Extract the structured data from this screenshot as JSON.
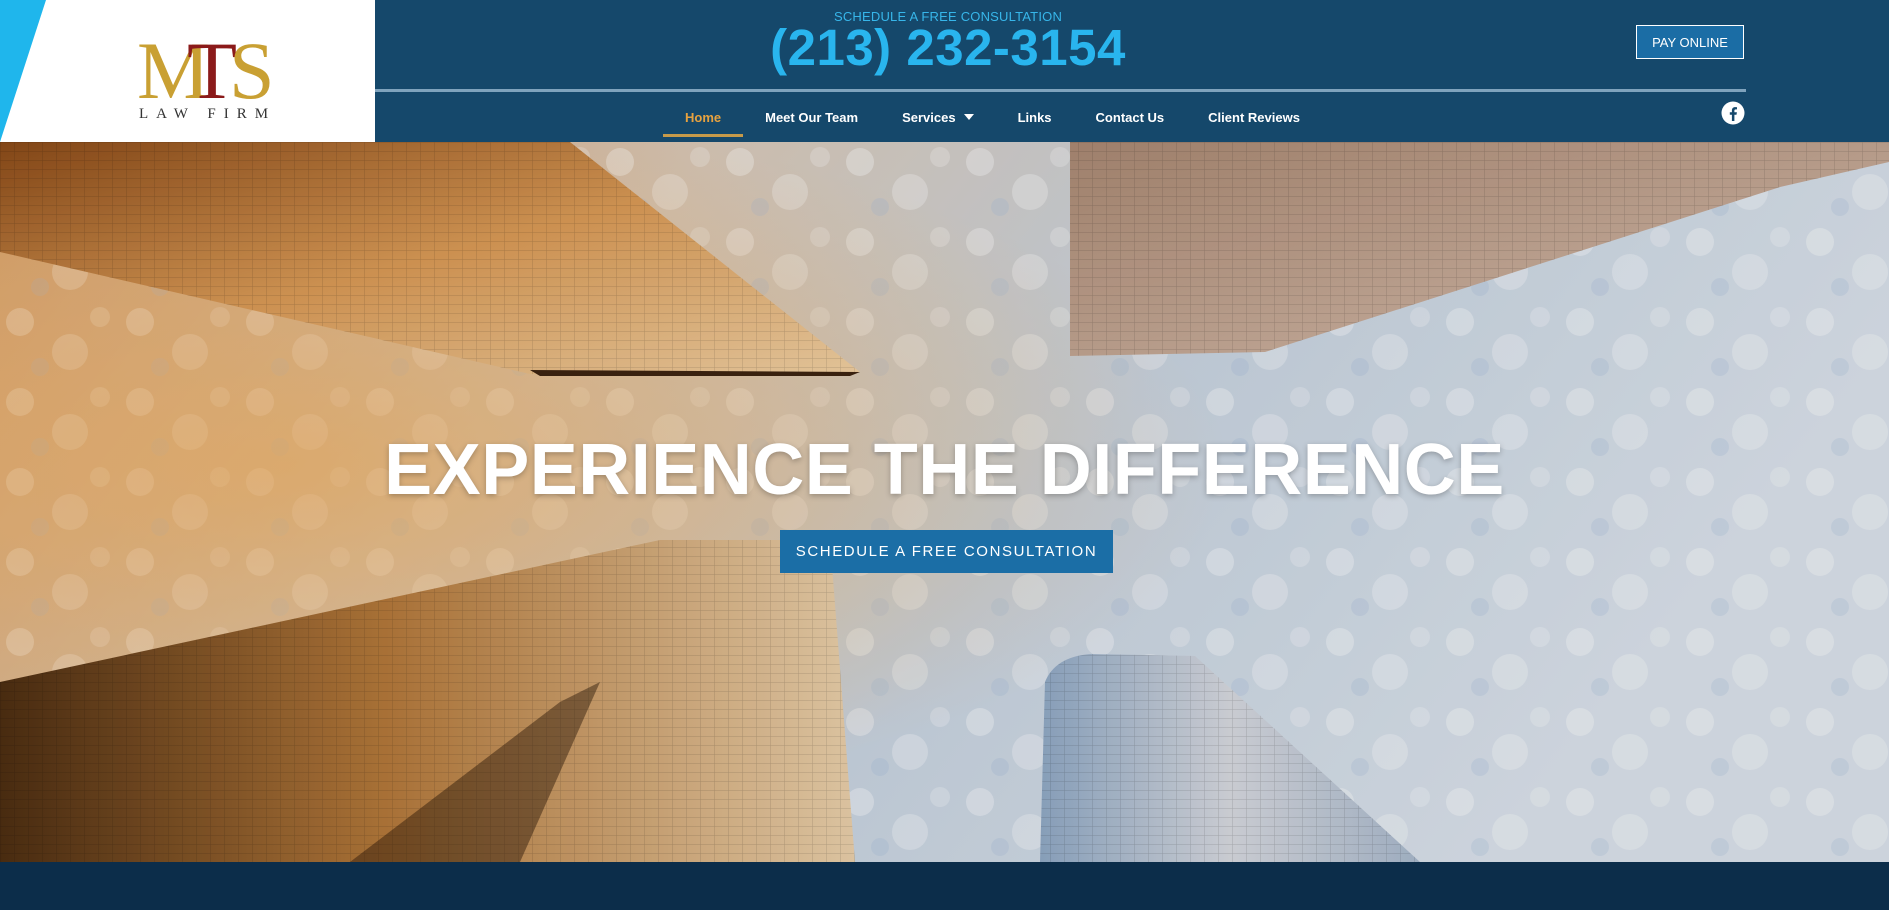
{
  "header": {
    "logo": {
      "monogram": "MTS",
      "subtitle": "LAW FIRM"
    },
    "consult_label": "SCHEDULE A FREE CONSULTATION",
    "phone": "(213) 232-3154",
    "pay_button": "PAY ONLINE",
    "nav": [
      {
        "label": "Home",
        "active": true
      },
      {
        "label": "Meet Our Team"
      },
      {
        "label": "Services",
        "has_dropdown": true
      },
      {
        "label": "Links"
      },
      {
        "label": "Contact Us"
      },
      {
        "label": "Client Reviews"
      }
    ],
    "social_icon": "facebook-icon"
  },
  "hero": {
    "title": "EXPERIENCE THE DIFFERENCE",
    "cta": "SCHEDULE A FREE CONSULTATION"
  },
  "colors": {
    "header_bg": "#15486b",
    "accent_cyan": "#29b5ee",
    "nav_active": "#e7a23f",
    "button_blue": "#1b6ea6",
    "logo_gold": "#c9a033",
    "logo_red": "#8b1a1a",
    "footer_bg": "#0c2d4a"
  }
}
